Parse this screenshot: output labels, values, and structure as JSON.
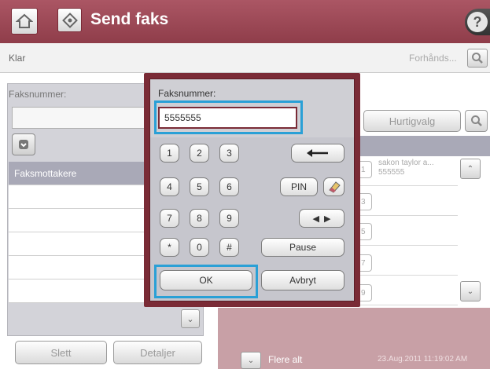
{
  "header": {
    "title": "Send faks",
    "home_icon": "home-icon",
    "app_icon": "fax-send-icon",
    "help_icon": "help-icon",
    "help_glyph": "?",
    "color": "#9b4553"
  },
  "status": {
    "text": "Klar",
    "preview_label": "Forhånds...",
    "preview_icon": "magnifier-icon"
  },
  "left_panel": {
    "label": "Faksnummer:",
    "list_title": "Faksmottakere",
    "download_icon": "arrow-down-icon",
    "scroll_down_icon": "chevron-down-icon"
  },
  "right_panel": {
    "quick_button": "Hurtigvalg",
    "search_icon": "magnifier-icon",
    "entry_name": "sakon taylor a...",
    "entry_number": "555555",
    "visible_indices": [
      "1",
      "3",
      "5",
      "7",
      "9"
    ]
  },
  "footer": {
    "delete_button": "Slett",
    "details_button": "Detaljer",
    "more_options": "Flere alt",
    "datetime": "23.Aug.2011 11:19:02 AM"
  },
  "dialog": {
    "label": "Faksnummer:",
    "input_value": "5555555",
    "keys": {
      "k1": "1",
      "k2": "2",
      "k3": "3",
      "k4": "4",
      "k5": "5",
      "k6": "6",
      "k7": "7",
      "k8": "8",
      "k9": "9",
      "kstar": "*",
      "k0": "0",
      "khash": "#"
    },
    "pin": "PIN",
    "pause": "Pause",
    "ok": "OK",
    "cancel": "Avbryt",
    "accent": "#2aa0d6"
  }
}
